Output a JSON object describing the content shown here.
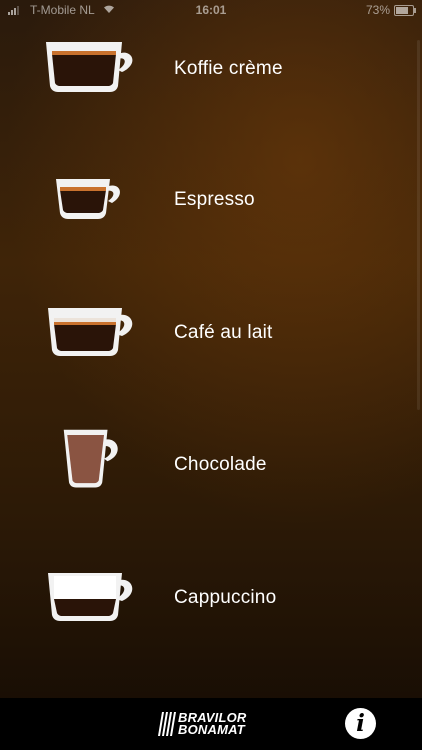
{
  "status_bar": {
    "carrier": "T-Mobile NL",
    "time": "16:01",
    "battery": "73%",
    "wifi_icon": "wifi-icon",
    "signal_icon": "signal-icon",
    "battery_icon": "battery-icon"
  },
  "drinks": [
    {
      "label": "Koffie crème",
      "icon": "koffie-creme-cup-icon"
    },
    {
      "label": "Espresso",
      "icon": "espresso-cup-icon"
    },
    {
      "label": "Café au lait",
      "icon": "cafe-au-lait-cup-icon"
    },
    {
      "label": "Chocolade",
      "icon": "chocolade-cup-icon"
    },
    {
      "label": "Cappuccino",
      "icon": "cappuccino-cup-icon"
    }
  ],
  "bottom_bar": {
    "logo_line1": "BRAVILOR",
    "logo_line2": "BONAMAT",
    "info_glyph": "i",
    "info_icon": "info-icon"
  },
  "colors": {
    "background_top": "#2a1a0c",
    "background_mid": "#3f2408",
    "cup_white": "#f2f2f2",
    "coffee_dark": "#2a1408",
    "crema": "#c9722e",
    "chocolate": "#8a5442",
    "bottom_bar": "#000000",
    "text": "#ffffff"
  }
}
